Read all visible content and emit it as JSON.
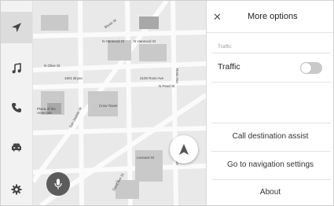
{
  "rail": {
    "items": [
      {
        "icon": "navigation-arrow-icon",
        "active": true
      },
      {
        "icon": "music-note-icon",
        "active": false
      },
      {
        "icon": "phone-icon",
        "active": false
      },
      {
        "icon": "car-icon",
        "active": false
      },
      {
        "icon": "gear-icon",
        "active": false
      }
    ]
  },
  "map": {
    "streets": [
      "N Harwood St",
      "N Harwood St",
      "N Olive St",
      "N Pearl St",
      "Ross Ave",
      "San Jacinto St",
      "Leonard St",
      "Ross Ave",
      "2100 Ross Ave",
      "Crow Tower",
      "Plaza of the Americas",
      "1601 Bryan",
      "Saint Ann St",
      "Bryan St"
    ],
    "nav_button_icon": "navigation-arrow-icon",
    "mic_button_icon": "microphone-icon"
  },
  "panel": {
    "title": "More options",
    "close_icon": "close-icon",
    "section_label": "Traffic",
    "traffic_label": "Traffic",
    "traffic_enabled": false,
    "actions": [
      "Call destination assist",
      "Go to navigation settings",
      "About"
    ]
  }
}
